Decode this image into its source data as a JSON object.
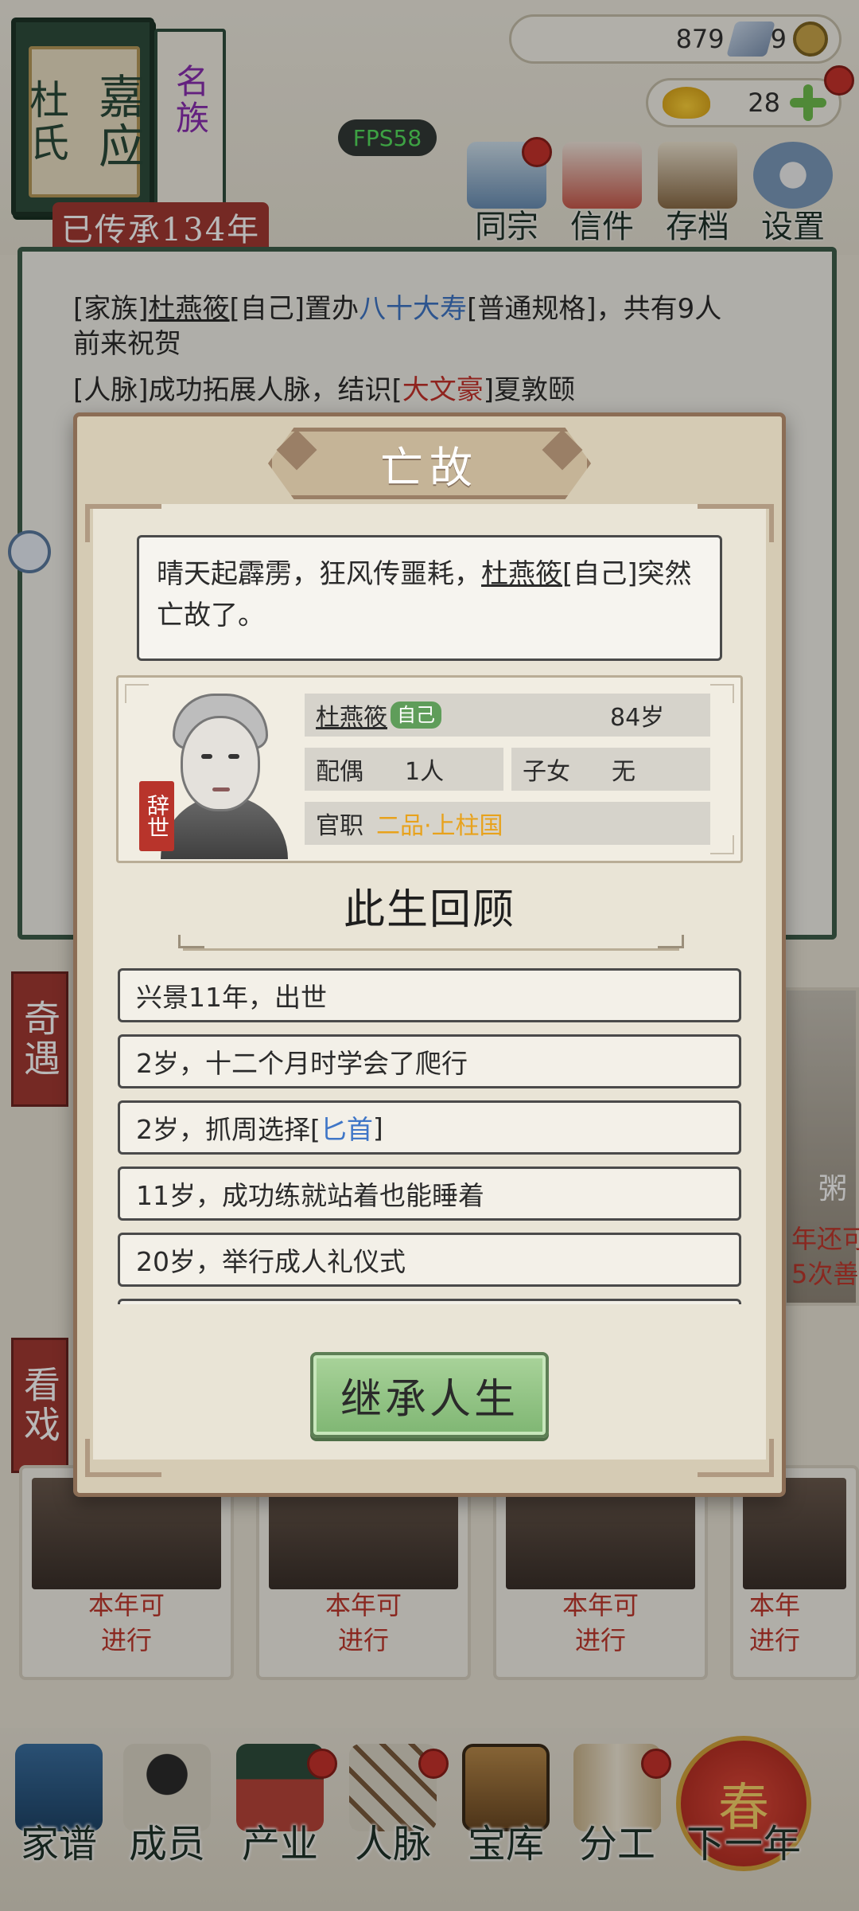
{
  "family": {
    "book_title_line1": "嘉应",
    "book_title_line2": "杜氏",
    "clan_rank": "名族",
    "heritage": "已传承134年"
  },
  "fps": "FPS58",
  "resources": {
    "silver": "879",
    "coins": "9",
    "gold": "28"
  },
  "top_menu": [
    {
      "label": "同宗",
      "icon": "books-icon"
    },
    {
      "label": "信件",
      "icon": "letters-icon"
    },
    {
      "label": "存档",
      "icon": "scroll-brush-icon"
    },
    {
      "label": "设置",
      "icon": "gear-icon"
    }
  ],
  "log": {
    "line1": {
      "prefix": "[家族]",
      "name": "杜燕筱",
      "mid": "[自己]置办",
      "event": "八十大寿",
      "suffix": "[普通规格]，共有9人"
    },
    "line2": "前来祝贺",
    "line3": {
      "prefix": "[人脉]成功拓展人脉，结识[",
      "title": "大文豪",
      "suffix": "]夏敦颐"
    }
  },
  "side_tags": [
    "奇遇",
    "看戏"
  ],
  "bg_cards": [
    {
      "line1": "本年可",
      "line2": "进行"
    },
    {
      "line1": "本年可",
      "line2": "进行"
    },
    {
      "line1": "本年可",
      "line2": "进行"
    },
    {
      "line1": "本年",
      "line2": "进行"
    }
  ],
  "right_peek": {
    "line1": "年还可",
    "line2": "5次善",
    "food": "粥"
  },
  "modal": {
    "title": "亡故",
    "message_pre": "晴天起霹雳，狂风传噩耗，",
    "message_name": "杜燕筱",
    "message_post": "[自己]突然亡故了。",
    "profile": {
      "seal": "辞世",
      "name": "杜燕筱",
      "self_tag": "自己",
      "age": "84岁",
      "spouse_label": "配偶",
      "spouse_value": "1人",
      "children_label": "子女",
      "children_value": "无",
      "office_label": "官职",
      "office_value": "二品·上柱国"
    },
    "review_title": "此生回顾",
    "review": [
      {
        "text": "兴景11年，出世"
      },
      {
        "text": "2岁，十二个月时学会了爬行"
      },
      {
        "pre": "2岁，抓周选择[",
        "item": "匕首",
        "post": "]"
      },
      {
        "text": "11岁，成功练就站着也能睡着"
      },
      {
        "text": "20岁，举行成人礼仪式"
      }
    ],
    "inherit_button": "继承人生"
  },
  "bottom_nav": [
    {
      "label": "家谱",
      "icon": "genealogy-icon"
    },
    {
      "label": "成员",
      "icon": "member-icon"
    },
    {
      "label": "产业",
      "icon": "building-icon"
    },
    {
      "label": "人脉",
      "icon": "network-icon"
    },
    {
      "label": "宝库",
      "icon": "treasure-chest-icon"
    },
    {
      "label": "分工",
      "icon": "scroll-icon"
    },
    {
      "label": "下一年",
      "icon": "lantern-icon",
      "lantern_char": "春"
    }
  ],
  "colors": {
    "dark_green": "#2f4d3c",
    "seal_red": "#a23a32",
    "accent_blue": "#3f76c7",
    "accent_red": "#c6322c",
    "office_orange": "#e8a21c",
    "button_green": "#7fb673"
  }
}
